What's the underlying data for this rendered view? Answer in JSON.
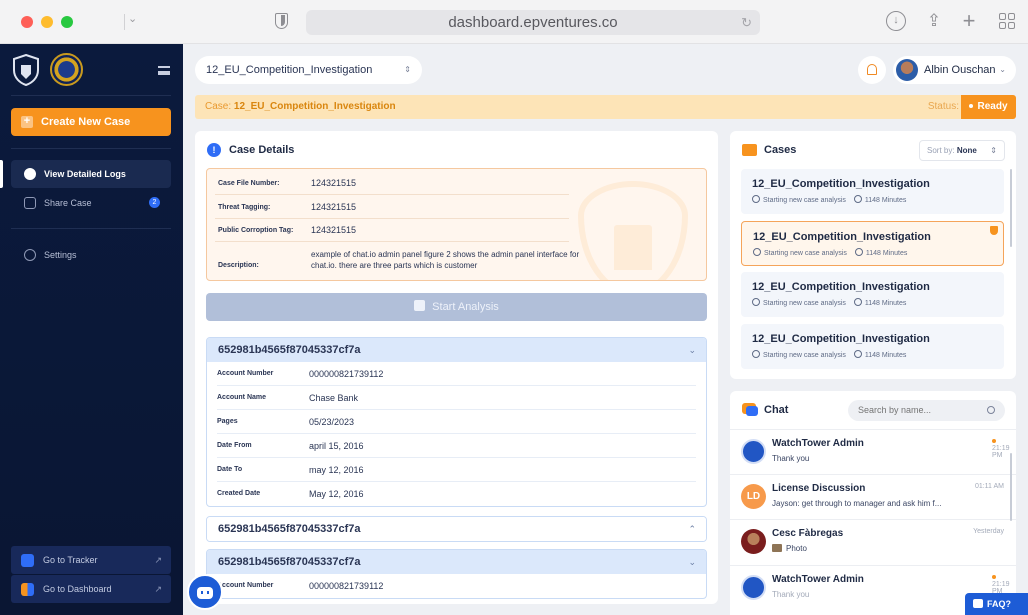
{
  "browser": {
    "url": "dashboard.epventures.co"
  },
  "sidebar": {
    "create_label": "Create New Case",
    "nav": [
      {
        "label": "View Detailed Logs"
      },
      {
        "label": "Share Case",
        "badge": "2"
      },
      {
        "label": "Settings"
      }
    ],
    "links": [
      {
        "label": "Go to Tracker"
      },
      {
        "label": "Go to Dashboard"
      }
    ]
  },
  "header": {
    "case_select": "12_EU_Competition_Investigation",
    "user_name": "Albin Ouschan"
  },
  "case_bar": {
    "prefix": "Case:",
    "case_name": "12_EU_Competition_Investigation",
    "status_label": "Status:",
    "status_value": "Ready"
  },
  "details": {
    "title": "Case Details",
    "rows": [
      {
        "label": "Case File Number:",
        "value": "124321515"
      },
      {
        "label": "Threat Tagging:",
        "value": "124321515"
      },
      {
        "label": "Public Corroption Tag:",
        "value": "124321515"
      },
      {
        "label": "Description:",
        "value": "example of chat.io admin panel figure 2 shows the admin panel interface for chat.io. there are three parts which is customer"
      }
    ],
    "start_label": "Start Analysis"
  },
  "accounts": [
    {
      "id": "652981b4565f87045337cf7a",
      "rows": [
        {
          "label": "Account Number",
          "value": "000000821739112"
        },
        {
          "label": "Account Name",
          "value": "Chase Bank"
        },
        {
          "label": "Pages",
          "value": "05/23/2023"
        },
        {
          "label": "Date From",
          "value": "april 15, 2016"
        },
        {
          "label": "Date To",
          "value": "may 12, 2016"
        },
        {
          "label": "Created Date",
          "value": "May 12, 2016"
        }
      ]
    },
    {
      "id": "652981b4565f87045337cf7a"
    },
    {
      "id": "652981b4565f87045337cf7a",
      "rows": [
        {
          "label": "Account Number",
          "value": "000000821739112"
        }
      ]
    }
  ],
  "cases": {
    "title": "Cases",
    "sort_label": "Sort by:",
    "sort_value": "None",
    "items": [
      {
        "name": "12_EU_Competition_Investigation",
        "status": "Starting new case analysis",
        "minutes": "1148 Minutes"
      },
      {
        "name": "12_EU_Competition_Investigation",
        "status": "Starting new case analysis",
        "minutes": "1148 Minutes"
      },
      {
        "name": "12_EU_Competition_Investigation",
        "status": "Starting new case analysis",
        "minutes": "1148 Minutes"
      },
      {
        "name": "12_EU_Competition_Investigation",
        "status": "Starting new case analysis",
        "minutes": "1148 Minutes"
      }
    ]
  },
  "chat": {
    "title": "Chat",
    "search_placeholder": "Search by name...",
    "messages": [
      {
        "name": "WatchTower Admin",
        "text": "Thank you",
        "time": "21:19 PM"
      },
      {
        "name": "License Discussion",
        "initials": "LD",
        "text": "Jayson: get through to manager and ask him f...",
        "time": "01:11 AM"
      },
      {
        "name": "Cesc Fàbregas",
        "text": "Photo",
        "time": "Yesterday"
      },
      {
        "name": "WatchTower Admin",
        "text": "Thank you",
        "time": "21:19 PM"
      }
    ]
  },
  "faq_label": "FAQ?",
  "colors": {
    "accent": "#f7931e",
    "sidebar": "#0b1a3d",
    "primary": "#2f6df6"
  }
}
